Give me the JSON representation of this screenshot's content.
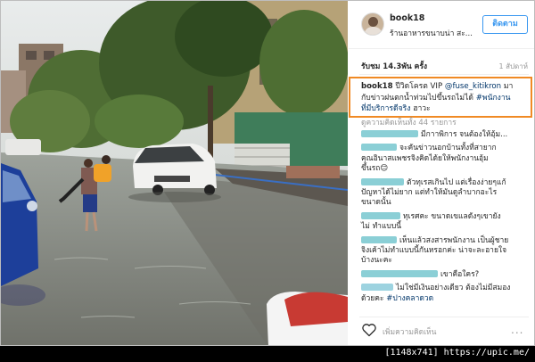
{
  "post": {
    "username": "book18",
    "location": "ร้านอาหารขนาบน่า สะ...",
    "follow_label": "ติดตาม",
    "views": "รับชม 14.3พัน ครั้ง",
    "time_ago": "1 สัปดาห์",
    "caption": {
      "user": "book18",
      "line1": " ปีวิดโครต VIP ",
      "mention": "@fuse_kitikron",
      "line1b": " มา",
      "line2a": "กับข่าวฝนตกน้ำท่วมไปขึ้นรถไม่ได้ ",
      "hashtag": "#พนักงาน",
      "line3a": "ที่มีบริการดีจริง",
      "line3b": " ฮาวะ"
    },
    "more_comments": "ดูความคิดเห็นทั้ง 44 รายการ",
    "add_comment_placeholder": "เพิ่มความคิดเห็น",
    "more_icon": "..."
  },
  "comments": [
    {
      "lines": [
        "มีกาาพิการ จนต้องให้อุ้ม..."
      ]
    },
    {
      "lines": [
        "จะคันข่าวนอกบ้านทั้งที่สายาก",
        "คุณอินาสแพชรจิงคิดได้ยให้พนักงานอุ้ม",
        "ขึ้นรถ😊"
      ]
    },
    {
      "lines": [
        "ตัวทุเรสเกินไป แต่เรื่องง่ายๆแก้",
        "ปัญหาได้ไม่ยาก แต่ทำให้มันดูลำบากอะไร",
        "ขนาดนั้น"
      ]
    },
    {
      "lines": [
        "ทุเรศคะ ขนาดเขแลดังๆเขายัง",
        "ไม่ ทำแบบนี้"
      ]
    },
    {
      "lines": [
        "เห็นแล้วสงสารพนักงาน เป็นผู้ชาย",
        "จิงเค้าไม่ทำแบบนี้กันหรอกค่ะ น่าจะละอายใจ",
        "บ้างนะคะ"
      ]
    },
    {
      "lines": [
        "เขาคือใคร?"
      ]
    },
    {
      "lines": [
        "ไม่ใช่มีเงินอย่างเดียว ต้องไม่มีสมอง",
        "ด้วยคะ "
      ],
      "tag": "#ปางคลาดวด"
    }
  ],
  "footer": {
    "text": "[1148x741] https://upic.me/"
  },
  "colors": {
    "accent": "#3897f0",
    "highlight_border": "#f08a24",
    "hashtag": "#003569",
    "redacted": "#8bcfd6"
  }
}
